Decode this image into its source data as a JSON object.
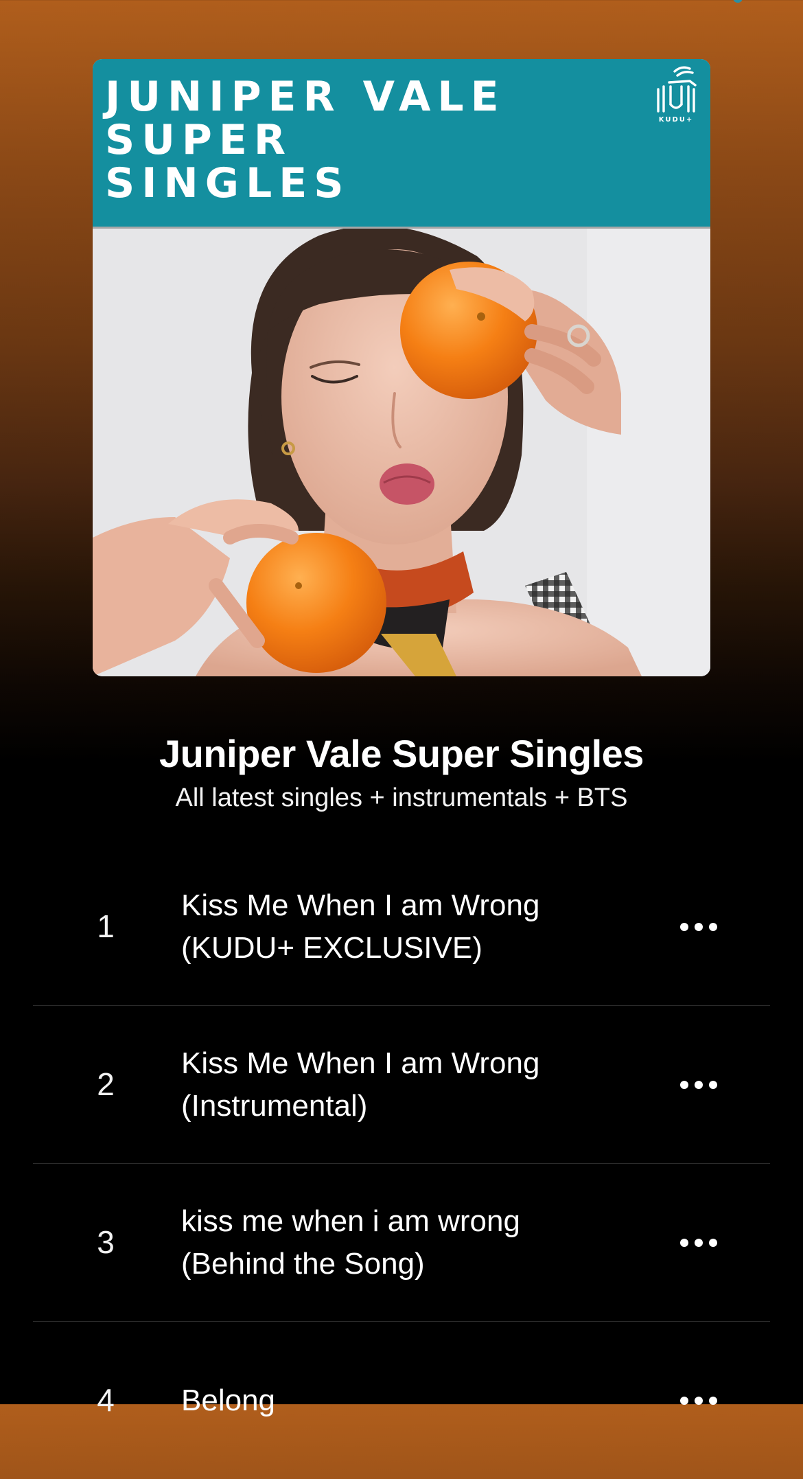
{
  "cover": {
    "title": "JUNIPER VALE\nSUPER\nSINGLES",
    "brand": "KUDU+",
    "band_color": "#148f9f",
    "logo_icon": "kudu-logo-icon",
    "photo_icon": "album-photo"
  },
  "playlist": {
    "title": "Juniper Vale Super Singles",
    "subtitle": "All latest singles + instrumentals + BTS"
  },
  "tracks": [
    {
      "number": "1",
      "title_line1": "Kiss Me When I am Wrong",
      "title_line2": "(KUDU+ EXCLUSIVE)",
      "menu_icon": "more-options-icon"
    },
    {
      "number": "2",
      "title_line1": "Kiss Me When I am Wrong",
      "title_line2": "(Instrumental)",
      "menu_icon": "more-options-icon"
    },
    {
      "number": "3",
      "title_line1": "kiss me when i am wrong",
      "title_line2": "(Behind the Song)",
      "menu_icon": "more-options-icon"
    },
    {
      "number": "4",
      "title_line1": "Belong",
      "title_line2": "",
      "menu_icon": "more-options-icon"
    }
  ],
  "colors": {
    "background_top": "#b05e1c",
    "background_bottom": "#000000",
    "text": "#ffffff"
  }
}
